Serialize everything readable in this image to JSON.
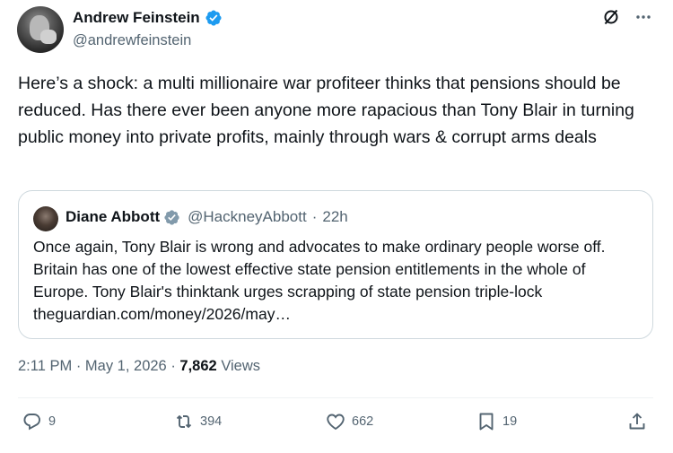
{
  "author": {
    "display_name": "Andrew Feinstein",
    "handle": "@andrewfeinstein",
    "verified": true
  },
  "top_actions": {
    "grok_icon": "grok-icon",
    "more_icon": "more-icon"
  },
  "tweet": {
    "text": "Here’s a shock: a multi millionaire war profiteer thinks that pensions should be reduced. Has there ever been anyone more rapacious than Tony Blair in turning public money into private profits, mainly through wars & corrupt arms deals"
  },
  "quoted_tweet": {
    "display_name": "Diane Abbott",
    "handle": "@HackneyAbbott",
    "separator": "·",
    "time": "22h",
    "text": "Once again, Tony Blair is wrong and advocates to make ordinary people worse off. Britain has one of the lowest effective state pension entitlements in the whole of Europe. Tony Blair's thinktank urges scrapping of state pension triple-lock theguardian.com/money/2026/may…"
  },
  "meta": {
    "time": "2:11 PM",
    "separator": "·",
    "date": "May 1, 2026",
    "views_count": "7,862",
    "views_label": "Views"
  },
  "actions": {
    "replies": "9",
    "reposts": "394",
    "likes": "662",
    "bookmarks": "19"
  },
  "colors": {
    "verified_blue": "#1d9bf0",
    "secondary_text": "#536471",
    "primary_text": "#0f1419",
    "border": "#cfd9de"
  }
}
